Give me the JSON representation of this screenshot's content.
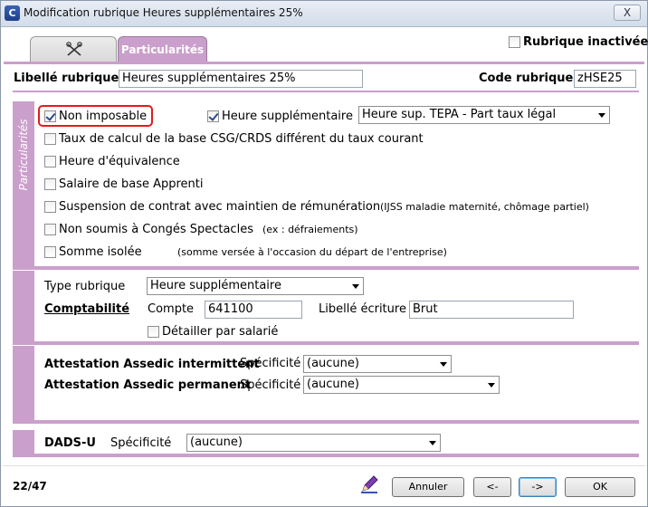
{
  "window": {
    "title": "Modification rubrique Heures supplémentaires 25%",
    "close_label": "X",
    "app_icon_letter": "C"
  },
  "tabs": [
    {
      "label": "",
      "icon": "scissors-tool-icon"
    },
    {
      "label": "Particularités"
    }
  ],
  "header": {
    "inactive_label": "Rubrique inactivée",
    "inactive_checked": false,
    "libelle_label": "Libellé rubrique",
    "libelle_value": "Heures supplémentaires 25%",
    "code_label": "Code rubrique",
    "code_value": "zHSE25"
  },
  "particularites": {
    "section_title": "Particularités",
    "non_imposable": {
      "label": "Non imposable",
      "checked": true
    },
    "heure_sup": {
      "label": "Heure supplémentaire",
      "checked": true
    },
    "heure_sup_select": "Heure sup. TEPA - Part taux légal",
    "options": [
      {
        "label": "Taux de calcul de la base CSG/CRDS différent du taux courant",
        "checked": false,
        "note": ""
      },
      {
        "label": "Heure d'équivalence",
        "checked": false,
        "note": ""
      },
      {
        "label": "Salaire de base Apprenti",
        "checked": false,
        "note": ""
      },
      {
        "label": "Suspension de contrat avec maintien de rémunération",
        "checked": false,
        "note": "(IJSS maladie maternité, chômage partiel)"
      },
      {
        "label": "Non soumis à Congés Spectacles",
        "checked": false,
        "note": "(ex : défraiements)"
      },
      {
        "label": "Somme isolée",
        "checked": false,
        "note": "(somme versée à l'occasion du départ de l'entreprise)"
      }
    ]
  },
  "type_section": {
    "type_label": "Type rubrique",
    "type_value": "Heure supplémentaire",
    "comptabilite_label": "Comptabilité",
    "compte_label": "Compte",
    "compte_value": "641100",
    "libelle_ecriture_label": "Libellé écriture",
    "libelle_ecriture_value": "Brut",
    "detailler_label": "Détailler par salarié",
    "detailler_checked": false
  },
  "assedic": {
    "intermittent_label": "Attestation Assedic intermittent",
    "permanent_label": "Attestation Assedic permanent",
    "specificite_label": "Spécificité",
    "intermittent_value": "(aucune)",
    "permanent_value": "(aucune)"
  },
  "dads": {
    "label": "DADS-U",
    "specificite_label": "Spécificité",
    "value": "(aucune)"
  },
  "footer": {
    "counter": "22/47",
    "pen_icon": "pen-icon",
    "cancel_label": "Annuler",
    "prev_label": "<-",
    "next_label": "->",
    "ok_label": "OK"
  },
  "colors": {
    "accent": "#cb9fcb",
    "highlight": "#e21b1b"
  }
}
